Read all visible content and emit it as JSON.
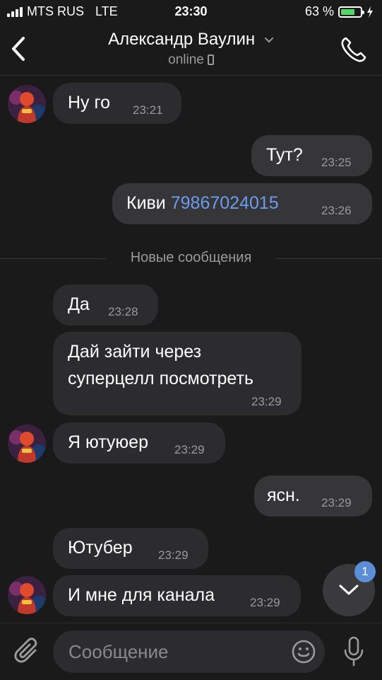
{
  "status_bar": {
    "carrier": "MTS RUS",
    "network": "LTE",
    "time": "23:30",
    "battery_percent": "63 %",
    "battery_level": 0.63
  },
  "header": {
    "contact_name": "Александр Ваулин",
    "status": "online"
  },
  "messages": [
    {
      "direction": "in",
      "text": "Ну го",
      "time": "23:21"
    },
    {
      "direction": "out",
      "text": "Тут?",
      "time": "23:25"
    },
    {
      "direction": "out",
      "text": "Киви",
      "link": "79867024015",
      "time": "23:26"
    },
    {
      "direction": "in",
      "text": "Да",
      "time": "23:28"
    },
    {
      "direction": "in",
      "text_line1": "Дай зайти через",
      "text_line2": "суперцелл посмотреть",
      "time": "23:29"
    },
    {
      "direction": "in",
      "text": "Я ютуюер",
      "time": "23:29"
    },
    {
      "direction": "out",
      "text": "ясн.",
      "time": "23:29"
    },
    {
      "direction": "in",
      "text": "Ютубер",
      "time": "23:29"
    },
    {
      "direction": "in",
      "text": "И мне для канала",
      "time": "23:29"
    }
  ],
  "divider_label": "Новые сообщения",
  "composer": {
    "placeholder": "Сообщение"
  },
  "unread_badge": "1",
  "colors": {
    "background": "#1a1a1a",
    "incoming_bubble": "#2c2c2e",
    "outgoing_bubble": "#363638",
    "link": "#6b9cf0",
    "badge": "#5a8fd8",
    "battery": "#4cd964"
  }
}
